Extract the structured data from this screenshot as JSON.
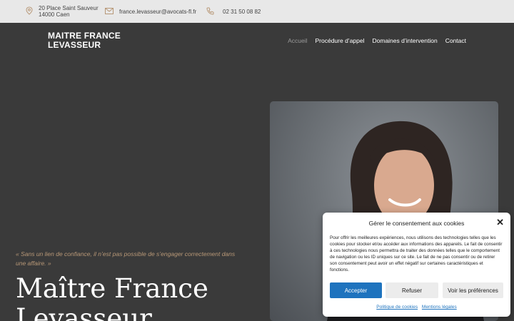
{
  "topbar": {
    "address_line1": "20 Place Saint Sauveur",
    "address_line2": "14000 Caen",
    "email": "france.levasseur@avocats-fl.fr",
    "phone": "02 31 50 08 82"
  },
  "header": {
    "logo_line1": "MAITRE FRANCE",
    "logo_line2": "LEVASSEUR",
    "nav": [
      {
        "label": "Accueil",
        "active": true
      },
      {
        "label": "Procédure d’appel"
      },
      {
        "label": "Domaines d’intervention"
      },
      {
        "label": "Contact"
      }
    ]
  },
  "hero": {
    "quote": "« Sans un lien de confiance, il n’est pas possible de s’engager correctement dans une affaire. »",
    "title_line1": "Maître France",
    "title_line2": "Levasseur"
  },
  "cookie": {
    "title": "Gérer le consentement aux cookies",
    "body": "Pour offrir les meilleures expériences, nous utilisons des technologies telles que les cookies pour stocker et/ou accéder aux informations des appareils. Le fait de consentir à ces technologies nous permettra de traiter des données telles que le comportement de navigation ou les ID uniques sur ce site. Le fait de ne pas consentir ou de retirer son consentement peut avoir un effet négatif sur certaines caractéristiques et fonctions.",
    "accept": "Accepter",
    "refuse": "Refuser",
    "prefs": "Voir les préférences",
    "link_policy": "Politique de cookies",
    "link_legal": "Mentions légales"
  },
  "colors": {
    "topbar_bg": "#e8e8e8",
    "page_bg": "#3a3a3a",
    "accent_gold": "#b89877",
    "accept_blue": "#1e73be"
  },
  "icons": [
    "map-pin-icon",
    "mail-icon",
    "phone-icon",
    "close-icon"
  ]
}
